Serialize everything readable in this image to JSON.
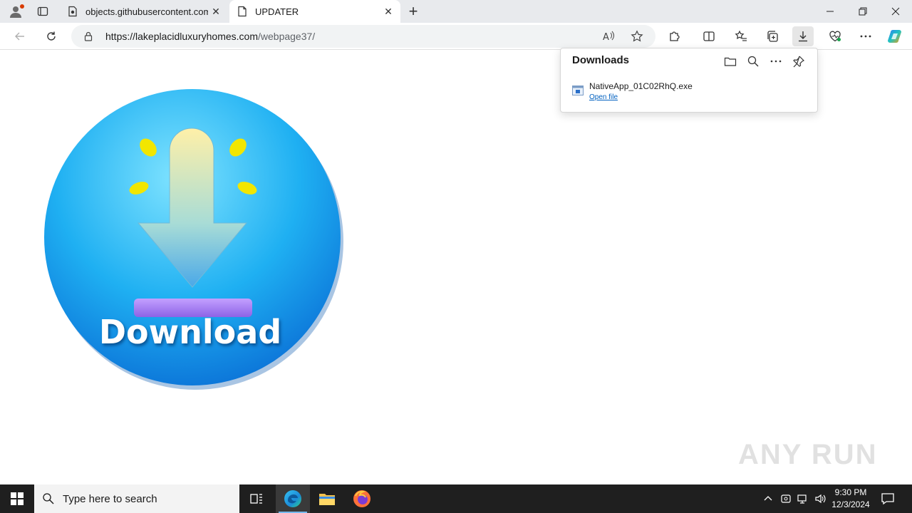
{
  "browser": {
    "tabs": [
      {
        "title": "objects.githubusercontent.com",
        "active": false
      },
      {
        "title": "UPDATER",
        "active": true
      }
    ],
    "address": {
      "host": "https://lakeplacidluxuryhomes.com",
      "path": "/webpage37/"
    }
  },
  "page": {
    "hero_text": "Download",
    "watermark": "ANY RUN"
  },
  "downloads_panel": {
    "title": "Downloads",
    "items": [
      {
        "file_name": "NativeApp_01C02RhQ.exe",
        "action_label": "Open file"
      }
    ]
  },
  "taskbar": {
    "search_placeholder": "Type here to search",
    "time": "9:30 PM",
    "date": "12/3/2024"
  },
  "colors": {
    "accent": "#0078d4",
    "hero_blue": "#1aa3f0",
    "hero_bar": "#a879f0",
    "leaf": "#f2e600",
    "taskbar": "#1f1f1f"
  }
}
